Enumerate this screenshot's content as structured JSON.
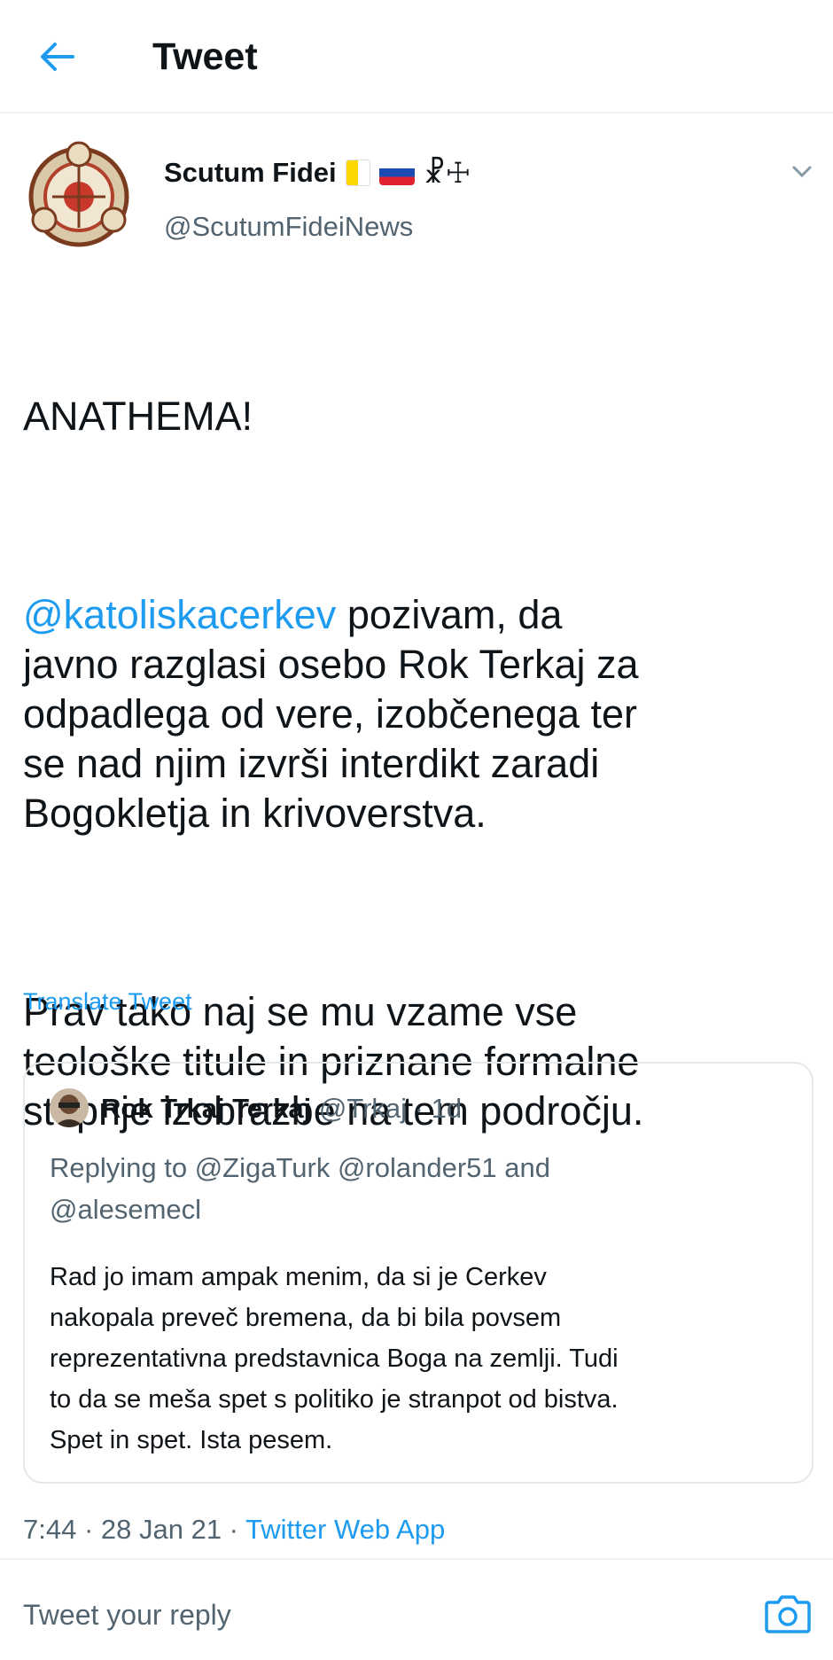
{
  "header": {
    "title": "Tweet",
    "back_icon": "arrow-left-icon"
  },
  "author": {
    "name": "Scutum Fidei",
    "emoji_suffix": "☧☩",
    "handle": "@ScutumFideiNews"
  },
  "tweet": {
    "para1": "ANATHEMA!",
    "mention": "@katoliskacerkev",
    "para2_rest": " pozivam, da\njavno razglasi osebo Rok Terkaj za\nodpadlega od vere, izobčenega ter\nse nad njim izvrši interdikt zaradi\nBogokletja in krivoverstva.",
    "para3": "Prav tako naj se mu vzame vse\nteološke titule in priznane formalne\nstopnje izobrazbe na tem področju.",
    "translate_label": "Translate Tweet"
  },
  "quote": {
    "name": "Rok Trkaj Terkaj",
    "handle_time": "@Trkaj · 1d",
    "replying_to": "Replying to @ZigaTurk @rolander51 and\n@alesemecl",
    "body": "Rad jo imam ampak menim, da si je Cerkev\nnakopala preveč bremena, da bi bila povsem\nreprezentativna predstavnica Boga na zemlji. Tudi\nto da se meša spet s politiko je stranpot od bistva.\nSpet in spet. Ista pesem."
  },
  "meta": {
    "time_date": "7:44 · 28 Jan 21 · ",
    "source": "Twitter Web App"
  },
  "reply": {
    "placeholder": "Tweet your reply",
    "camera_icon": "camera-icon"
  },
  "colors": {
    "accent": "#1d9bf0",
    "muted": "#536471",
    "text": "#0f1419"
  }
}
